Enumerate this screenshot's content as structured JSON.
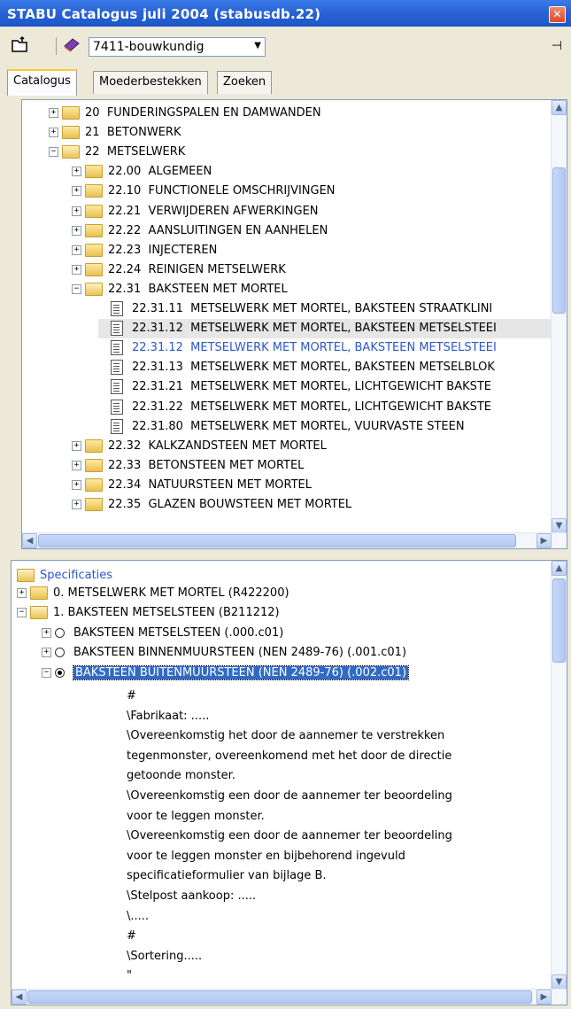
{
  "window": {
    "title": "STABU Catalogus juli 2004 (stabusdb.22)",
    "close_glyph": "✕"
  },
  "toolbar": {
    "combo_value": "7411-bouwkundig",
    "combo_arrow": "▼",
    "pin_glyph": "⊣"
  },
  "tabs": [
    {
      "label": "Catalogus",
      "active": true
    },
    {
      "label": "Moederbestekken",
      "active": false
    },
    {
      "label": "Zoeken",
      "active": false
    }
  ],
  "catalog_tree": [
    {
      "expander": "+",
      "icon": "folder",
      "code": "20",
      "text": "FUNDERINGSPALEN EN DAMWANDEN"
    },
    {
      "expander": "+",
      "icon": "folder",
      "code": "21",
      "text": "BETONWERK"
    },
    {
      "expander": "−",
      "icon": "folder-open",
      "code": "22",
      "text": "METSELWERK"
    },
    {
      "expander": "+",
      "icon": "folder",
      "code": "22.00",
      "text": "ALGEMEEN"
    },
    {
      "expander": "+",
      "icon": "folder",
      "code": "22.10",
      "text": "FUNCTIONELE OMSCHRIJVINGEN"
    },
    {
      "expander": "+",
      "icon": "folder",
      "code": "22.21",
      "text": "VERWIJDEREN AFWERKINGEN"
    },
    {
      "expander": "+",
      "icon": "folder",
      "code": "22.22",
      "text": "AANSLUITINGEN EN AANHELEN"
    },
    {
      "expander": "+",
      "icon": "folder",
      "code": "22.23",
      "text": "INJECTEREN"
    },
    {
      "expander": "+",
      "icon": "folder",
      "code": "22.24",
      "text": "REINIGEN METSELWERK"
    },
    {
      "expander": "−",
      "icon": "folder-open",
      "code": "22.31",
      "text": "BAKSTEEN MET MORTEL"
    },
    {
      "expander": "",
      "icon": "doc",
      "code": "22.31.11",
      "text": "METSELWERK MET MORTEL, BAKSTEEN STRAATKLINI"
    },
    {
      "expander": "",
      "icon": "doc",
      "code": "22.31.12",
      "text": "METSELWERK MET MORTEL, BAKSTEEN METSELSTEEI",
      "selected": true
    },
    {
      "expander": "",
      "icon": "doc",
      "code": "22.31.12",
      "text": "METSELWERK MET MORTEL, BAKSTEEN METSELSTEEI",
      "blue": true
    },
    {
      "expander": "",
      "icon": "doc",
      "code": "22.31.13",
      "text": "METSELWERK MET MORTEL, BAKSTEEN METSELBLOK"
    },
    {
      "expander": "",
      "icon": "doc",
      "code": "22.31.21",
      "text": "METSELWERK MET MORTEL, LICHTGEWICHT BAKSTE"
    },
    {
      "expander": "",
      "icon": "doc",
      "code": "22.31.22",
      "text": "METSELWERK MET MORTEL, LICHTGEWICHT BAKSTE"
    },
    {
      "expander": "",
      "icon": "doc",
      "code": "22.31.80",
      "text": "METSELWERK MET MORTEL, VUURVASTE STEEN"
    },
    {
      "expander": "+",
      "icon": "folder",
      "code": "22.32",
      "text": "KALKZANDSTEEN MET MORTEL"
    },
    {
      "expander": "+",
      "icon": "folder",
      "code": "22.33",
      "text": "BETONSTEEN MET MORTEL"
    },
    {
      "expander": "+",
      "icon": "folder",
      "code": "22.34",
      "text": "NATUURSTEEN MET MORTEL"
    },
    {
      "expander": "+",
      "icon": "folder",
      "code": "22.35",
      "text": "GLAZEN BOUWSTEEN MET MORTEL"
    }
  ],
  "spec": {
    "root_label": "Specificaties",
    "items": [
      {
        "expander": "+",
        "kind": "folder",
        "text": "0.  METSELWERK MET MORTEL  (R422200)"
      },
      {
        "expander": "−",
        "kind": "folder-open",
        "text": "1.  BAKSTEEN METSELSTEEN  (B211212)"
      },
      {
        "expander": "+",
        "kind": "radio",
        "text": "BAKSTEEN METSELSTEEN  (.000.c01)"
      },
      {
        "expander": "+",
        "kind": "radio",
        "text": "BAKSTEEN BINNENMUURSTEEN (NEN 2489-76)  (.001.c01)"
      },
      {
        "expander": "−",
        "kind": "radio-on",
        "text": "BAKSTEEN BUITENMUURSTEEN (NEN 2489-76)  (.002.c01)",
        "selected": true
      }
    ],
    "text_lines": [
      "   #",
      "\\Fabrikaat: .....",
      "\\Overeenkomstig het door de aannemer te verstrekken",
      " tegenmonster, overeenkomend met het door de directie",
      " getoonde monster.",
      "\\Overeenkomstig een door de aannemer ter beoordeling",
      " voor te leggen monster.",
      "\\Overeenkomstig een door de aannemer ter beoordeling",
      " voor te leggen monster en bijbehorend ingevuld",
      " specificatieformulier van bijlage B.",
      "\\Stelpost aankoop: .....",
      "\\.....",
      "   #",
      "\\Sortering.....",
      "   \""
    ]
  },
  "scroll": {
    "up": "▲",
    "down": "▼",
    "left": "◀",
    "right": "▶",
    "grip": "≡",
    "hgrip": "|||"
  }
}
